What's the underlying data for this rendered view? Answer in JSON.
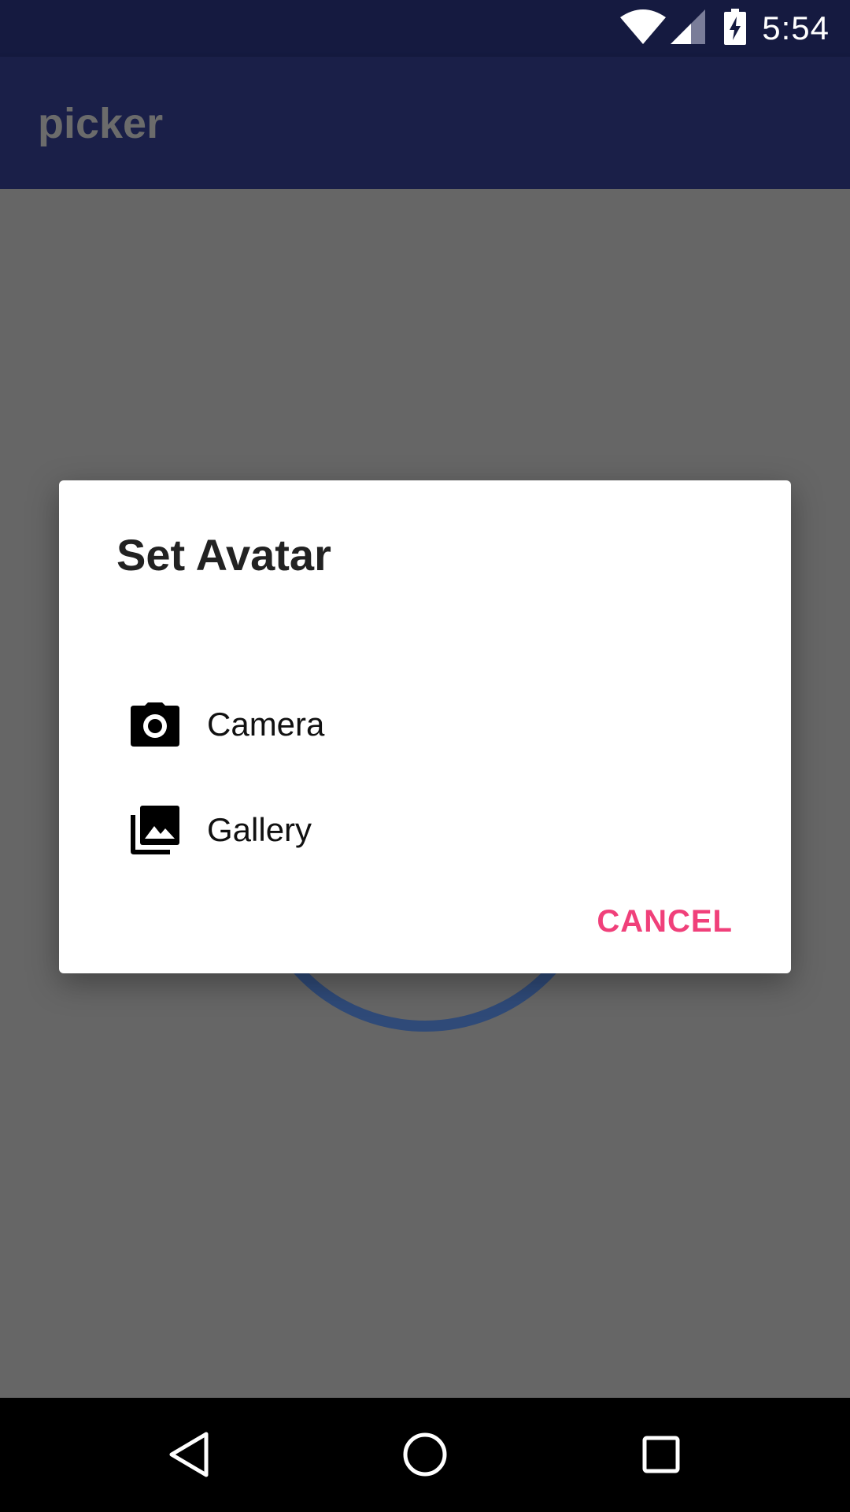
{
  "status_bar": {
    "time": "5:54",
    "icons": [
      "wifi-icon",
      "signal-icon",
      "battery-charging-icon"
    ]
  },
  "app_bar": {
    "title": "picker"
  },
  "dialog": {
    "title": "Set Avatar",
    "items": [
      {
        "label": "Camera",
        "icon": "camera-icon"
      },
      {
        "label": "Gallery",
        "icon": "gallery-icon"
      }
    ],
    "cancel_label": "CANCEL",
    "accent_color": "#f0407a"
  },
  "nav_bar": {
    "buttons": [
      "back-icon",
      "home-icon",
      "recents-icon"
    ]
  },
  "colors": {
    "status_bar": "#151a40",
    "app_bar": "#1a1f48",
    "scrim": "#666666",
    "avatar_ring": "#2f4a78"
  }
}
